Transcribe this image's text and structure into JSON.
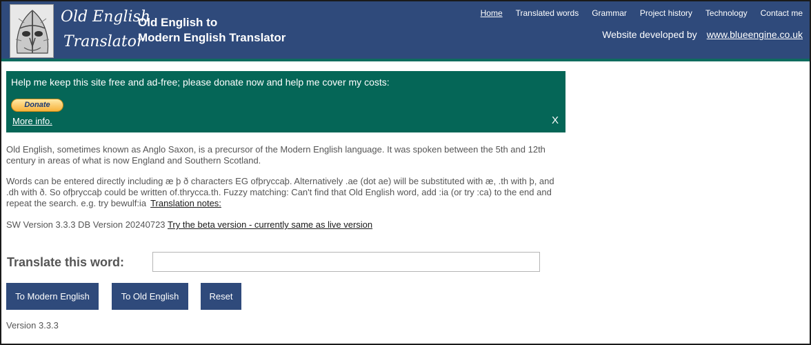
{
  "header": {
    "logo_line1": "Old English",
    "logo_line2": "Translator",
    "title_line1": "Old English to",
    "title_line2": "Modern English Translator",
    "developed_by": "Website developed by",
    "developer_link": "www.blueengine.co.uk",
    "background_color": "#2f4a7b",
    "accent_color": "#0e6b5e"
  },
  "nav": {
    "items": [
      "Home",
      "Translated words",
      "Grammar",
      "Project history",
      "Technology",
      "Contact me"
    ]
  },
  "donate": {
    "message": "Help me keep this site free and ad-free; please donate now and help me cover my costs:",
    "button_label": "Donate",
    "more_info": "More info.",
    "close_label": "X",
    "background_color": "#056657"
  },
  "intro": {
    "paragraph1": "Old English, sometimes known as Anglo Saxon, is a precursor of the Modern English language. It was spoken between the 5th and 12th century in areas of what is now England and Southern Scotland.",
    "paragraph2": "Words can be entered directly including æ þ ð characters EG ofþryccaþ. Alternatively .ae (dot ae) will be substituted with æ, .th with þ, and .dh with ð. So ofþryccaþ could be written of.thrycca.th. Fuzzy matching: Can't find that Old English word, add :ia (or try :ca) to the end and repeat the search. e.g. try bewulf:ia",
    "notes_link": "Translation notes:",
    "version_line": "SW Version 3.3.3 DB Version 20240723",
    "beta_link": "Try the beta version - currently same as live version"
  },
  "form": {
    "label": "Translate this word:",
    "input_value": "",
    "input_placeholder": "",
    "to_modern_button": "To Modern English",
    "to_old_button": "To Old English",
    "reset_button": "Reset",
    "button_color": "#2f4a7b"
  },
  "footer": {
    "version": "Version 3.3.3"
  }
}
